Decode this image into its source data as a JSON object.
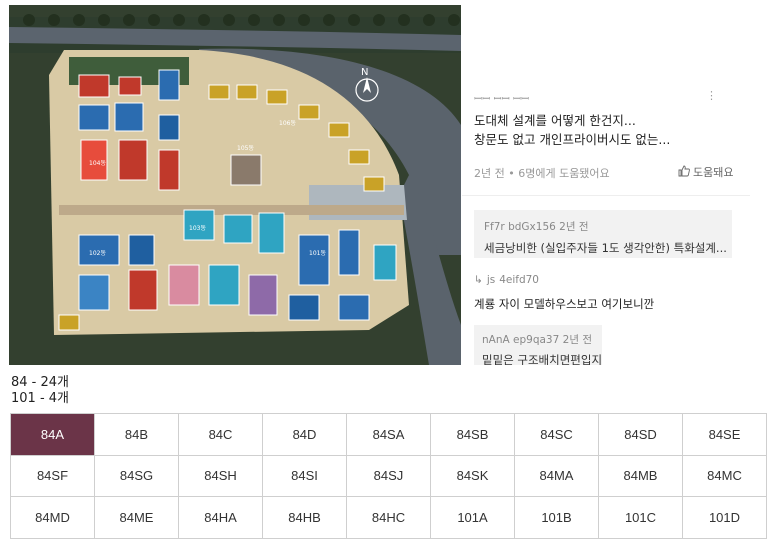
{
  "colors": {
    "accent": "#6b3448",
    "river": "#5d6570",
    "greenery": "#3e5a3b",
    "ground": "#d8c9a6"
  },
  "site_plan": {
    "labels": {
      "north": "N",
      "bldg_top_1": "105동",
      "bldg_top_2": "106동",
      "bldg_left": "104동",
      "bldg_mid": "103동",
      "bldg_right": "101동",
      "bldg_low": "102동"
    }
  },
  "comments": {
    "top": {
      "author": "ꟷꟷ ꟷꟷ ꟷꟷ",
      "text_line1": "도대체 설계를 어떻게 한건지...",
      "text_line2": "창문도 없고 개인프라이버시도 없는...",
      "meta": "2년 전 • 6명에게 도움됐어요",
      "helpful_label": "도움돼요"
    },
    "reply1": {
      "author": "Ff7r",
      "author_id": "bdGx156",
      "time": "2년 전",
      "text": "세금낭비한 (실입주자들 1도 생각안한) 특화설계..."
    },
    "comment2": {
      "author": "js",
      "author_id": "4eifd70",
      "text": "계룡 자이 모델하우스보고 여기보니깐"
    },
    "reply2": {
      "author": "nAnA",
      "author_id": "ep9qa37",
      "time": "2년 전",
      "text": "밑밑은 구조배치면편입지에"
    }
  },
  "counts": {
    "line1": "84 - 24개",
    "line2": "101 - 4개"
  },
  "unit_types": [
    {
      "label": "84A",
      "active": true
    },
    {
      "label": "84B"
    },
    {
      "label": "84C"
    },
    {
      "label": "84D"
    },
    {
      "label": "84SA"
    },
    {
      "label": "84SB"
    },
    {
      "label": "84SC"
    },
    {
      "label": "84SD"
    },
    {
      "label": "84SE"
    },
    {
      "label": "84SF"
    },
    {
      "label": "84SG"
    },
    {
      "label": "84SH"
    },
    {
      "label": "84SI"
    },
    {
      "label": "84SJ"
    },
    {
      "label": "84SK"
    },
    {
      "label": "84MA"
    },
    {
      "label": "84MB"
    },
    {
      "label": "84MC"
    },
    {
      "label": "84MD"
    },
    {
      "label": "84ME"
    },
    {
      "label": "84HA"
    },
    {
      "label": "84HB"
    },
    {
      "label": "84HC"
    },
    {
      "label": "101A"
    },
    {
      "label": "101B"
    },
    {
      "label": "101C"
    },
    {
      "label": "101D"
    }
  ]
}
